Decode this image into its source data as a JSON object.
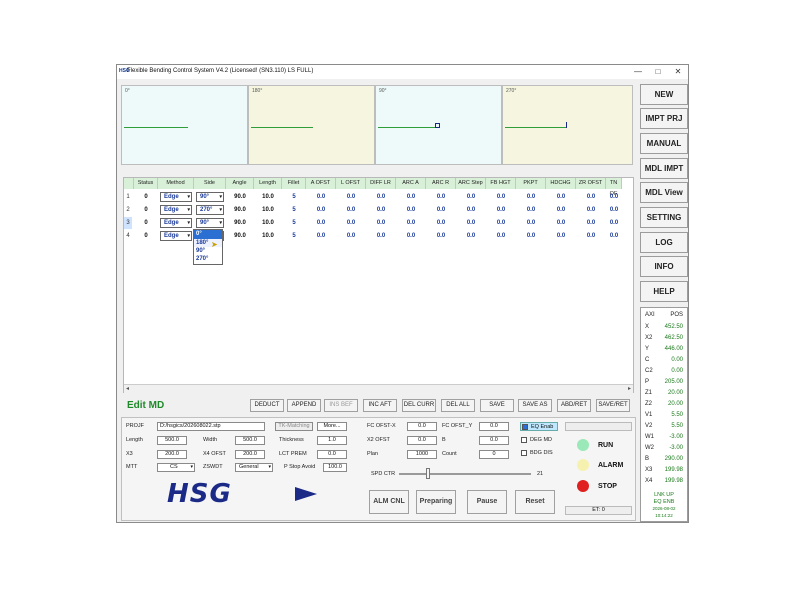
{
  "window": {
    "logo": "HSG",
    "title": "Flexible Bending Control System V4.2 (Licensed! (SN3.110) LS FULL)",
    "min_glyph": "—",
    "max_glyph": "□",
    "close_glyph": "✕"
  },
  "previews": [
    {
      "label": "0°"
    },
    {
      "label": "180°"
    },
    {
      "label": "90°"
    },
    {
      "label": "270°"
    }
  ],
  "side_buttons": [
    "NEW",
    "IMPT PRJ",
    "MANUAL",
    "MDL IMPT",
    "MDL View",
    "SETTING",
    "LOG",
    "INFO",
    "HELP"
  ],
  "table": {
    "columns": [
      "Status",
      "Method",
      "Side",
      "Angle",
      "Length",
      "Fillet",
      "A OFST",
      "L OFST",
      "DIFF LR",
      "ARC A",
      "ARC R",
      "ARC Step",
      "FB HGT",
      "PKPT",
      "HDCHG",
      "ZR OFST",
      "TN OF"
    ],
    "rows": [
      {
        "num": "1",
        "status": "0",
        "method": "Edge",
        "side": "90°",
        "angle": "90.0",
        "length": "10.0",
        "fillet": "5",
        "a_ofst": "0.0",
        "l_ofst": "0.0",
        "diff_lr": "0.0",
        "arc_a": "0.0",
        "arc_r": "0.0",
        "arc_step": "0.0",
        "fb_hgt": "0.0",
        "pkpt": "0.0",
        "hdchg": "0.0",
        "zr_ofst": "0.0",
        "tn_of": "0.0"
      },
      {
        "num": "2",
        "status": "0",
        "method": "Edge",
        "side": "270°",
        "angle": "90.0",
        "length": "10.0",
        "fillet": "5",
        "a_ofst": "0.0",
        "l_ofst": "0.0",
        "diff_lr": "0.0",
        "arc_a": "0.0",
        "arc_r": "0.0",
        "arc_step": "0.0",
        "fb_hgt": "0.0",
        "pkpt": "0.0",
        "hdchg": "0.0",
        "zr_ofst": "0.0",
        "tn_of": "0.0"
      },
      {
        "num": "3",
        "status": "0",
        "method": "Edge",
        "side": "90°",
        "angle": "90.0",
        "length": "10.0",
        "fillet": "5",
        "a_ofst": "0.0",
        "l_ofst": "0.0",
        "diff_lr": "0.0",
        "arc_a": "0.0",
        "arc_r": "0.0",
        "arc_step": "0.0",
        "fb_hgt": "0.0",
        "pkpt": "0.0",
        "hdchg": "0.0",
        "zr_ofst": "0.0",
        "tn_of": "0.0"
      },
      {
        "num": "4",
        "status": "0",
        "method": "Edge",
        "side": "0°",
        "angle": "90.0",
        "length": "10.0",
        "fillet": "5",
        "a_ofst": "0.0",
        "l_ofst": "0.0",
        "diff_lr": "0.0",
        "arc_a": "0.0",
        "arc_r": "0.0",
        "arc_step": "0.0",
        "fb_hgt": "0.0",
        "pkpt": "0.0",
        "hdchg": "0.0",
        "zr_ofst": "0.0",
        "tn_of": "0.0"
      }
    ],
    "side_options": [
      "0°",
      "180°",
      "90°",
      "270°"
    ]
  },
  "edit_mode": "Edit MD",
  "toolbar": [
    "DEDUCT",
    "APPEND",
    "INS BEF",
    "INC AFT",
    "DEL CURR",
    "DEL ALL",
    "SAVE",
    "SAVE AS",
    "ABD/RET",
    "SAVE/RET"
  ],
  "params": {
    "proj_label": "PROJF",
    "proj_value": "D:/hsgics/202608022.stp",
    "tk_matching": "TK-Matching",
    "more": "More...",
    "length_label": "Length",
    "length_value": "500.0",
    "width_label": "Width",
    "width_value": "500.0",
    "thickness_label": "Thickness",
    "thickness_value": "1.0",
    "x3_label": "X3",
    "x3_value": "200.0",
    "x4ofst_label": "X4 OFST",
    "x4ofst_value": "200.0",
    "lctprem_label": "LCT PREM",
    "lctprem_value": "0.0",
    "mtt_label": "MTT",
    "mtt_value": "CS",
    "zswdt_label": "ZSWDT",
    "zswdt_value": "General",
    "pstop_label": "P Stop Avoid",
    "pstop_value": "100.0",
    "fcofstx_label": "FC OFST-X",
    "fcofstx_value": "0.0",
    "fcofsty_label": "FC OFST_Y",
    "fcofsty_value": "0.0",
    "x2ofst_label": "X2 OFST",
    "x2ofst_value": "0.0",
    "b_label": "B",
    "b_value": "0.0",
    "plan_label": "Plan",
    "plan_value": "1000",
    "count_label": "Count",
    "count_value": "0",
    "eq_enab": "EQ Enab",
    "deg_md": "DEG MD",
    "bdg_dis": "BDG DIS",
    "spd_label": "SPD CTR",
    "spd_value": "21",
    "spd_fraction": 0.22
  },
  "brand": "HSG",
  "actions": [
    "ALM CNL",
    "Preparing",
    "Pause",
    "Reset"
  ],
  "indicators": [
    {
      "label": "RUN",
      "color": "#9be8b8"
    },
    {
      "label": "ALARM",
      "color": "#f7f1b0"
    },
    {
      "label": "STOP",
      "color": "#e02020"
    }
  ],
  "et_label": "ET: 0",
  "status": {
    "header_axis": "AXI",
    "header_pos": "POS",
    "axes": [
      {
        "k": "X",
        "v": "452.50"
      },
      {
        "k": "X2",
        "v": "462.50"
      },
      {
        "k": "Y",
        "v": "446.00"
      },
      {
        "k": "C",
        "v": "0.00"
      },
      {
        "k": "C2",
        "v": "0.00"
      },
      {
        "k": "P",
        "v": "205.00"
      },
      {
        "k": "Z1",
        "v": "20.00"
      },
      {
        "k": "Z2",
        "v": "20.00"
      },
      {
        "k": "V1",
        "v": "5.50"
      },
      {
        "k": "V2",
        "v": "5.50"
      },
      {
        "k": "W1",
        "v": "-3.00"
      },
      {
        "k": "W2",
        "v": "-3.00"
      },
      {
        "k": "B",
        "v": "290.00"
      },
      {
        "k": "X3",
        "v": "199.98"
      },
      {
        "k": "X4",
        "v": "199.98"
      }
    ],
    "lnk": "LNK UP",
    "eq": "EQ ENB",
    "date": "2026-08-02",
    "time": "10:14:22"
  }
}
